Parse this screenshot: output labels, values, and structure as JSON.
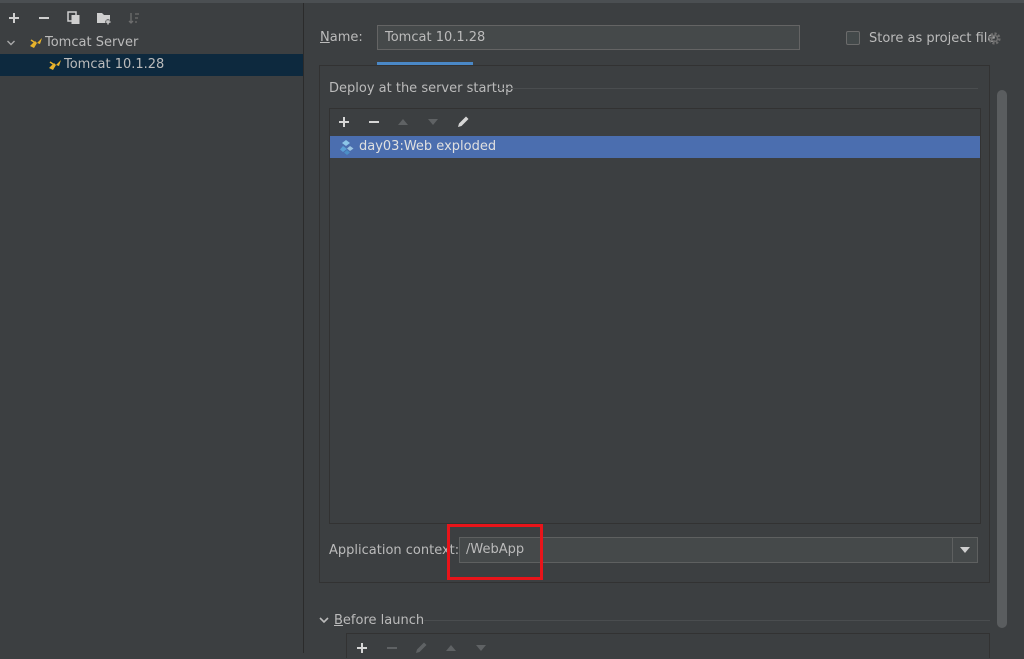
{
  "tree": {
    "group_label": "Tomcat Server",
    "item_label": "Tomcat 10.1.28"
  },
  "form": {
    "name_accel": "N",
    "name_rest": "ame:",
    "name_value": "Tomcat 10.1.28",
    "store_label": "Store as project file"
  },
  "deploy": {
    "section_title": "Deploy at the server startup",
    "artifact_label": "day03:Web exploded",
    "context_label": "Application context:",
    "context_value": "/WebApp"
  },
  "before_launch": {
    "accel": "B",
    "rest": "efore launch"
  },
  "colors": {
    "background": "#3c3f41",
    "selection_tree": "#0d293e",
    "selection_list": "#4b6eaf",
    "highlight_box": "#e8141a",
    "tab_indicator": "#4a88c7",
    "tomcat_icon": "#e8b32b"
  },
  "icons": {
    "left_toolbar": [
      "add-icon",
      "remove-icon",
      "copy-icon",
      "folder-add-icon",
      "sort-icon"
    ],
    "list_toolbar": [
      "add-icon",
      "remove-icon",
      "move-up-icon",
      "move-down-icon",
      "edit-icon"
    ],
    "artifact": "artifact-icon",
    "settings": "gear-icon"
  }
}
